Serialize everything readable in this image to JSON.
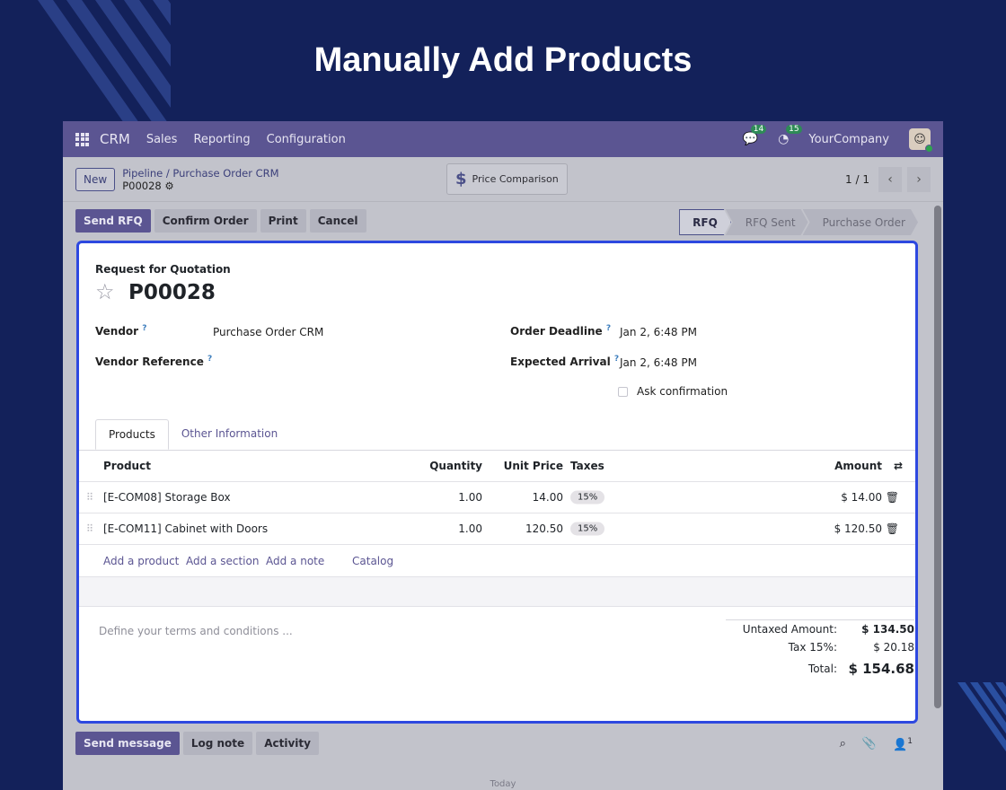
{
  "headline": "Manually Add Products",
  "nav": {
    "app_name": "CRM",
    "menus": [
      "Sales",
      "Reporting",
      "Configuration"
    ],
    "messages_count": "14",
    "activities_count": "15",
    "company": "YourCompany"
  },
  "control": {
    "new_label": "New",
    "breadcrumb_path": "Pipeline / Purchase Order CRM",
    "record_name": "P00028",
    "price_comparison_label": "Price Comparison",
    "pager": "1 / 1"
  },
  "actions": {
    "send_rfq": "Send RFQ",
    "confirm_order": "Confirm Order",
    "print": "Print",
    "cancel": "Cancel"
  },
  "status_steps": [
    "RFQ",
    "RFQ Sent",
    "Purchase Order"
  ],
  "form": {
    "doc_type": "Request for Quotation",
    "number": "P00028",
    "vendor_label": "Vendor",
    "vendor_value": "Purchase Order CRM",
    "vendor_ref_label": "Vendor Reference",
    "order_deadline_label": "Order Deadline",
    "order_deadline_value": "Jan 2, 6:48 PM",
    "expected_arrival_label": "Expected Arrival",
    "expected_arrival_value": "Jan 2, 6:48 PM",
    "ask_confirmation_label": "Ask confirmation",
    "help_mark": "?"
  },
  "tabs": [
    "Products",
    "Other Information"
  ],
  "table": {
    "headers": {
      "product": "Product",
      "quantity": "Quantity",
      "unit_price": "Unit Price",
      "taxes": "Taxes",
      "amount": "Amount"
    },
    "rows": [
      {
        "product": "[E-COM08] Storage Box",
        "quantity": "1.00",
        "unit_price": "14.00",
        "tax": "15%",
        "amount": "$ 14.00"
      },
      {
        "product": "[E-COM11] Cabinet with Doors",
        "quantity": "1.00",
        "unit_price": "120.50",
        "tax": "15%",
        "amount": "$ 120.50"
      }
    ],
    "add_product": "Add a product",
    "add_section": "Add a section",
    "add_note": "Add a note",
    "catalog": "Catalog"
  },
  "terms_placeholder": "Define your terms and conditions ...",
  "totals": {
    "untaxed_label": "Untaxed Amount:",
    "untaxed_value": "$ 134.50",
    "tax_label": "Tax 15%:",
    "tax_value": "$ 20.18",
    "total_label": "Total:",
    "total_value": "$ 154.68"
  },
  "chatter": {
    "send_message": "Send message",
    "log_note": "Log note",
    "activity": "Activity",
    "followers_count": "1",
    "today": "Today"
  },
  "colors": {
    "accent": "#5b5592",
    "background": "#13215a",
    "highlight_border": "#2d48e0"
  }
}
